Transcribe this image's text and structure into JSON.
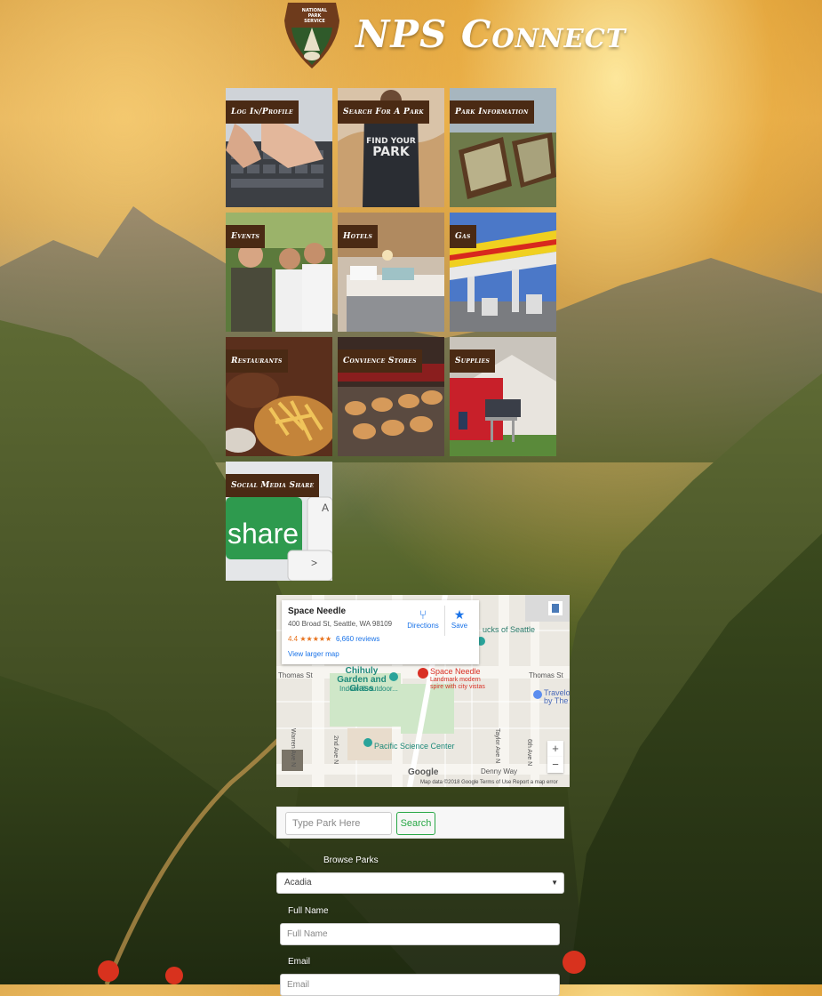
{
  "header": {
    "title": "NPS Connect",
    "logo_text": "NATIONAL PARK SERVICE"
  },
  "tiles": [
    {
      "label": "Log In/Profile"
    },
    {
      "label": "Search For A Park"
    },
    {
      "label": "Park Information"
    },
    {
      "label": "Events"
    },
    {
      "label": "Hotels"
    },
    {
      "label": "Gas"
    },
    {
      "label": "Restaurants"
    },
    {
      "label": "Convience Stores"
    },
    {
      "label": "Supplies"
    },
    {
      "label": "Social Media Share"
    }
  ],
  "map": {
    "place_name": "Space Needle",
    "address": "400 Broad St, Seattle, WA 98109",
    "rating": "4.4 ★★★★★",
    "reviews": "6,660 reviews",
    "larger_map": "View larger map",
    "directions": "Directions",
    "save": "Save",
    "labels": {
      "chihuly": "Chihuly Garden and Glass",
      "chihuly_sub": "Indoor & outdoor...",
      "space_needle": "Space Needle",
      "space_needle_sub": "Landmark modern spire with city vistas",
      "pacific": "Pacific Science Center",
      "starbucks": "ucks of Seattle",
      "travel": "Travelo by The",
      "denny": "Denny Way",
      "thomas_left": "Thomas St",
      "thomas_right": "Thomas St",
      "warren": "Warren Ave N",
      "second": "2nd Ave N",
      "taylor": "Taylor Ave N",
      "sixth": "6th Ave N",
      "google": "Google",
      "footer": "Map data ©2018 Google   Terms of Use   Report a map error"
    },
    "zoom_in": "+",
    "zoom_out": "−"
  },
  "search": {
    "placeholder": "Type Park Here",
    "button": "Search"
  },
  "browse": {
    "label": "Browse Parks",
    "selected": "Acadia"
  },
  "form": {
    "full_name_label": "Full Name",
    "full_name_placeholder": "Full Name",
    "email_label": "Email",
    "email_placeholder": "Email"
  },
  "colors": {
    "tile_label_bg": "#4a2a14",
    "accent_green": "#28a745",
    "map_link": "#1a73e8"
  }
}
